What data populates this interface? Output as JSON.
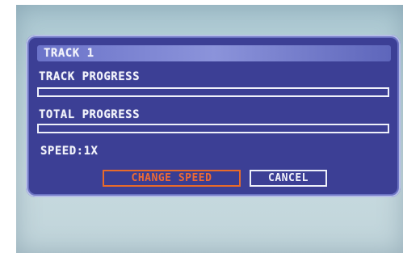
{
  "dialog": {
    "title": "TRACK 1",
    "track_progress": {
      "label": "TRACK PROGRESS",
      "value": 0
    },
    "total_progress": {
      "label": "TOTAL PROGRESS",
      "value": 0
    },
    "speed_text": "SPEED:1X",
    "buttons": {
      "change_speed": "CHANGE SPEED",
      "cancel": "CANCEL"
    }
  },
  "colors": {
    "dialog_bg": "#3c3f95",
    "title_bar": "#7b83d1",
    "selected_button": "#ef6a33",
    "text": "#f2f3fb"
  }
}
